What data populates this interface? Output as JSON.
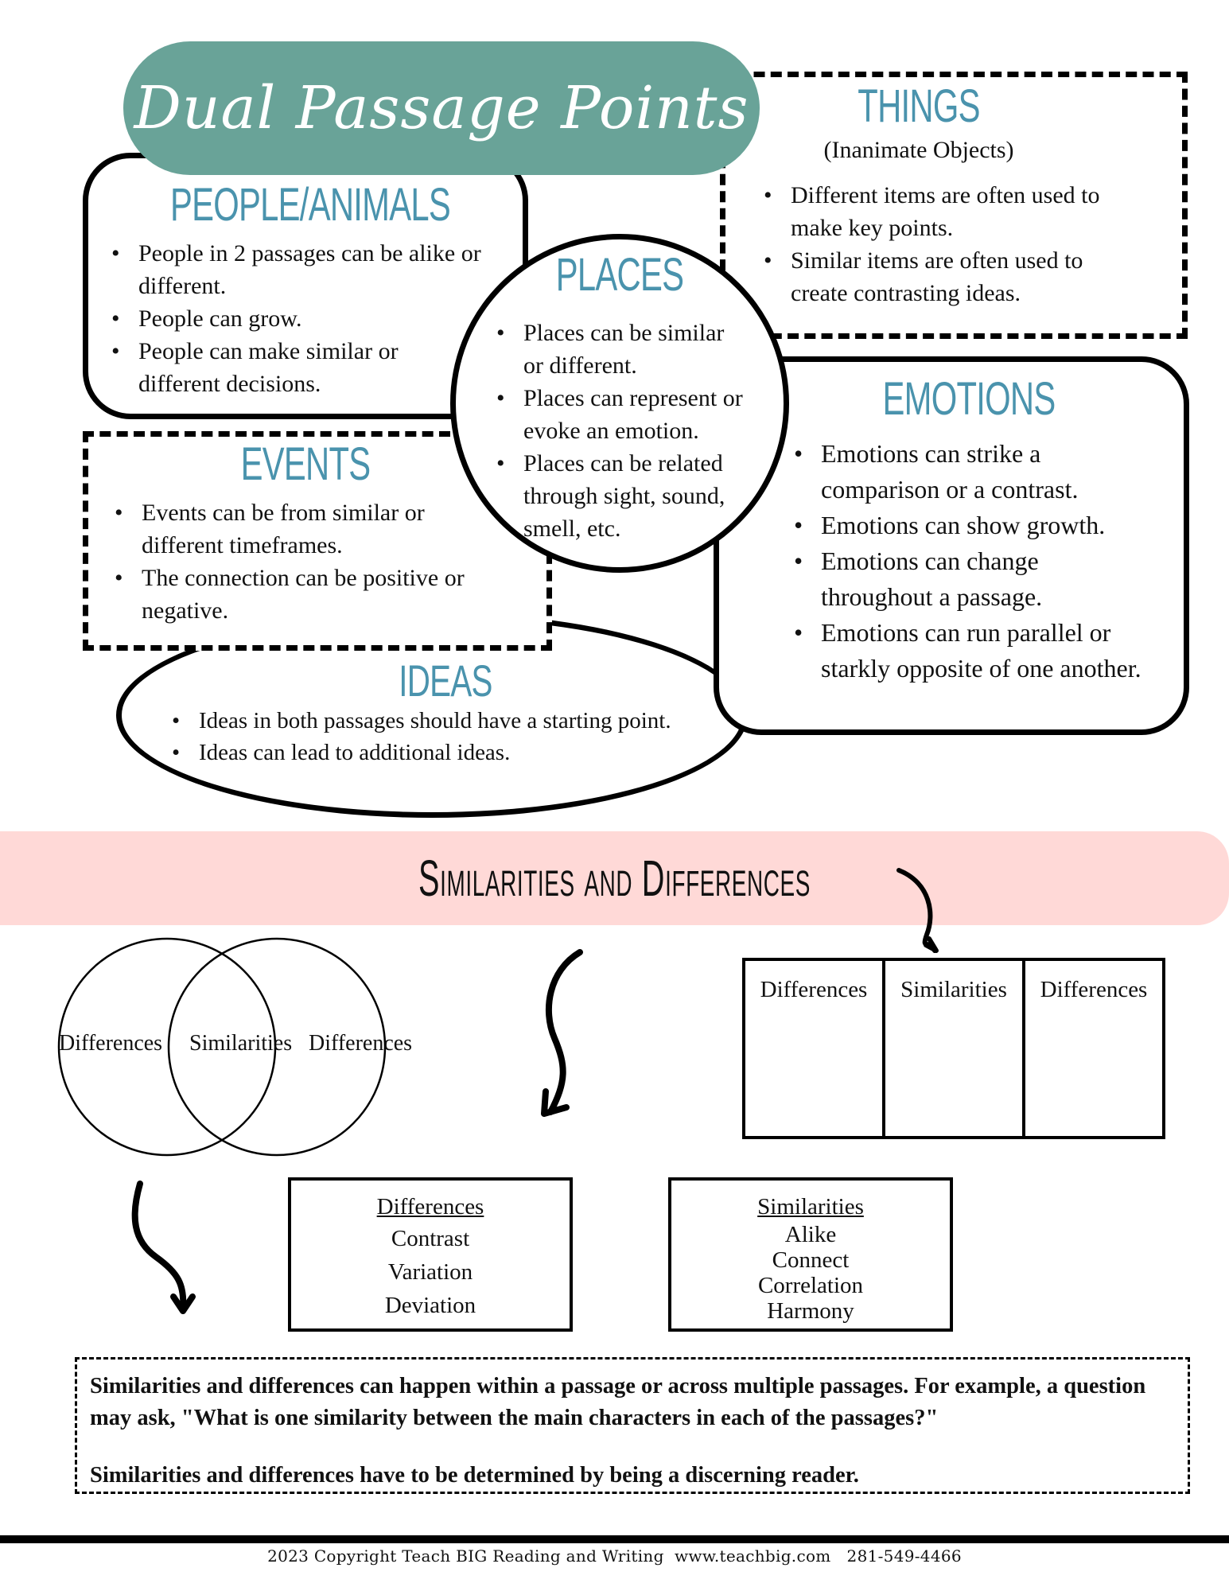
{
  "title": "Dual Passage Points",
  "sections": {
    "people": {
      "heading": "PEOPLE/ANIMALS",
      "bullets": [
        "People in 2 passages can be alike or different.",
        "People can grow.",
        "People can make similar or different decisions."
      ]
    },
    "things": {
      "heading": "THINGS",
      "subheading": "(Inanimate Objects)",
      "bullets": [
        "Different items are often used to make key points.",
        "Similar items are often used to create contrasting ideas."
      ]
    },
    "places": {
      "heading": "PLACES",
      "bullets": [
        "Places can be similar or different.",
        "Places can represent or evoke an emotion.",
        "Places can be related through sight, sound, smell, etc."
      ]
    },
    "emotions": {
      "heading": "EMOTIONS",
      "bullets": [
        "Emotions can strike a comparison or a contrast.",
        "Emotions can show growth.",
        "Emotions can change throughout a passage.",
        "Emotions can run parallel or starkly opposite of one another."
      ]
    },
    "events": {
      "heading": "EVENTS",
      "bullets": [
        "Events can be from similar or different timeframes.",
        "The connection can be positive or negative."
      ]
    },
    "ideas": {
      "heading": "IDEAS",
      "bullets": [
        "Ideas in both passages should have a starting point.",
        "Ideas can lead to additional ideas."
      ]
    }
  },
  "comparison": {
    "band_title": "Similarities and Differences",
    "venn": {
      "left": "Differences",
      "center": "Similarities",
      "right": "Differences"
    },
    "table_headers": [
      "Differences",
      "Similarities",
      "Differences"
    ],
    "differences_box": {
      "title": "Differences",
      "words": [
        "Contrast",
        "Variation",
        "Deviation"
      ]
    },
    "similarities_box": {
      "title": "Similarities",
      "words": [
        "Alike",
        "Connect",
        "Correlation",
        "Harmony"
      ]
    }
  },
  "note": {
    "paragraph1": "Similarities and differences can happen within a passage or across multiple passages. For example, a question may ask, \"What is one similarity between the main characters in each of the passages?\"",
    "paragraph2": "Similarities and differences have to be determined by being a discerning reader."
  },
  "footer": "2023 Copyright Teach BIG Reading and Writing  www.teachbig.com   281-549-4466",
  "colors": {
    "title_bg": "#69a398",
    "heading": "#4a93ad",
    "band_bg": "#ffd9d7"
  }
}
